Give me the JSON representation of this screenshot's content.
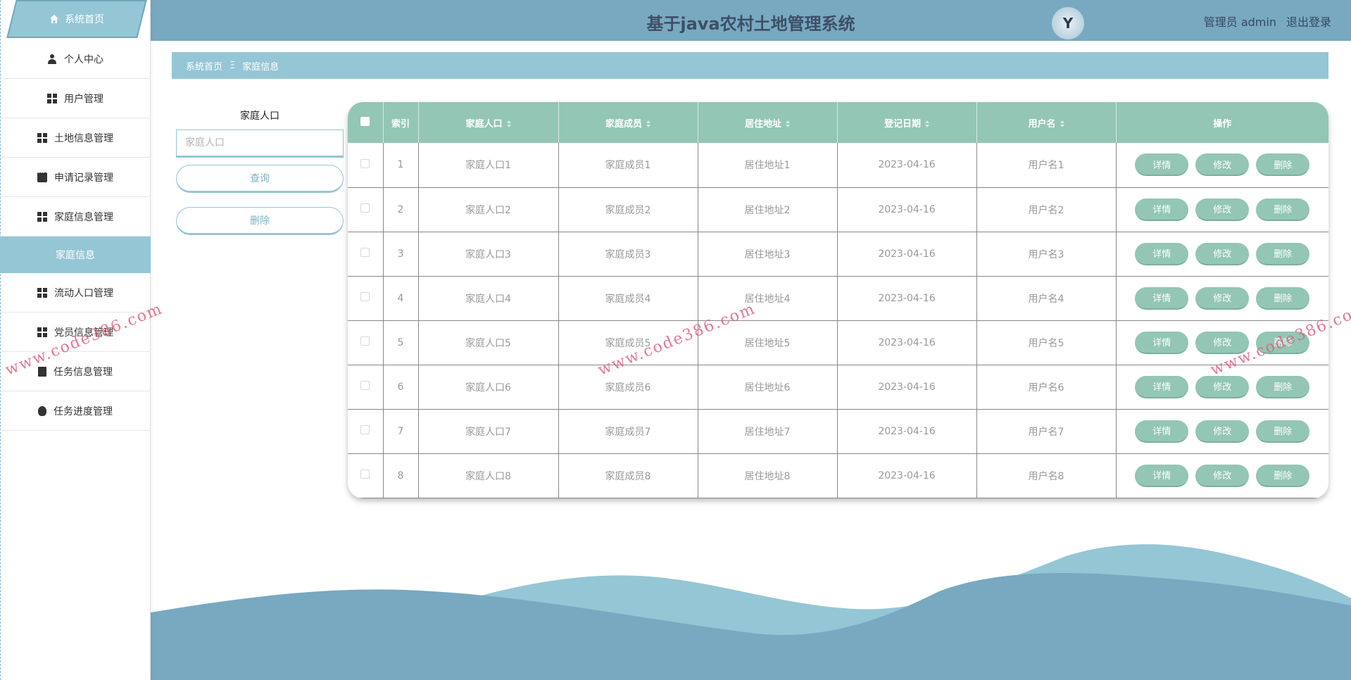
{
  "header": {
    "title": "基于java农村土地管理系统",
    "logo_text": "Y",
    "user_label": "管理员 admin",
    "logout_label": "退出登录"
  },
  "sidebar": {
    "home_label": "系统首页",
    "items": [
      {
        "label": "个人中心",
        "icon": "user-icon"
      },
      {
        "label": "用户管理",
        "icon": "grid-icon"
      },
      {
        "label": "土地信息管理",
        "icon": "grid-icon"
      },
      {
        "label": "申请记录管理",
        "icon": "chat-icon"
      },
      {
        "label": "家庭信息管理",
        "icon": "grid-icon"
      },
      {
        "label": "家庭信息",
        "icon": "",
        "active": true
      },
      {
        "label": "流动人口管理",
        "icon": "grid-icon"
      },
      {
        "label": "党员信息管理",
        "icon": "grid-icon"
      },
      {
        "label": "任务信息管理",
        "icon": "clipboard-icon"
      },
      {
        "label": "任务进度管理",
        "icon": "bulb-icon"
      }
    ]
  },
  "breadcrumb": {
    "home": "系统首页",
    "separator": "Ξ",
    "current": "家庭信息"
  },
  "search": {
    "label": "家庭人口",
    "placeholder": "家庭人口",
    "query_label": "查询",
    "delete_label": "删除"
  },
  "table": {
    "columns": [
      "索引",
      "家庭人口",
      "家庭成员",
      "居住地址",
      "登记日期",
      "用户名",
      "操作"
    ],
    "rows": [
      {
        "index": "1",
        "population": "家庭人口1",
        "members": "家庭成员1",
        "address": "居住地址1",
        "date": "2023-04-16",
        "username": "用户名1"
      },
      {
        "index": "2",
        "population": "家庭人口2",
        "members": "家庭成员2",
        "address": "居住地址2",
        "date": "2023-04-16",
        "username": "用户名2"
      },
      {
        "index": "3",
        "population": "家庭人口3",
        "members": "家庭成员3",
        "address": "居住地址3",
        "date": "2023-04-16",
        "username": "用户名3"
      },
      {
        "index": "4",
        "population": "家庭人口4",
        "members": "家庭成员4",
        "address": "居住地址4",
        "date": "2023-04-16",
        "username": "用户名4"
      },
      {
        "index": "5",
        "population": "家庭人口5",
        "members": "家庭成员5",
        "address": "居住地址5",
        "date": "2023-04-16",
        "username": "用户名5"
      },
      {
        "index": "6",
        "population": "家庭人口6",
        "members": "家庭成员6",
        "address": "居住地址6",
        "date": "2023-04-16",
        "username": "用户名6"
      },
      {
        "index": "7",
        "population": "家庭人口7",
        "members": "家庭成员7",
        "address": "居住地址7",
        "date": "2023-04-16",
        "username": "用户名7"
      },
      {
        "index": "8",
        "population": "家庭人口8",
        "members": "家庭成员8",
        "address": "居住地址8",
        "date": "2023-04-16",
        "username": "用户名8"
      }
    ],
    "actions": {
      "detail": "详情",
      "edit": "修改",
      "delete": "删除"
    }
  },
  "watermark": "www.code386.com",
  "colors": {
    "header": "#78a9c1",
    "accent": "#95c6d6",
    "table_header": "#93c6b4",
    "title_text": "#3d4f66",
    "watermark": "#e0607e"
  }
}
